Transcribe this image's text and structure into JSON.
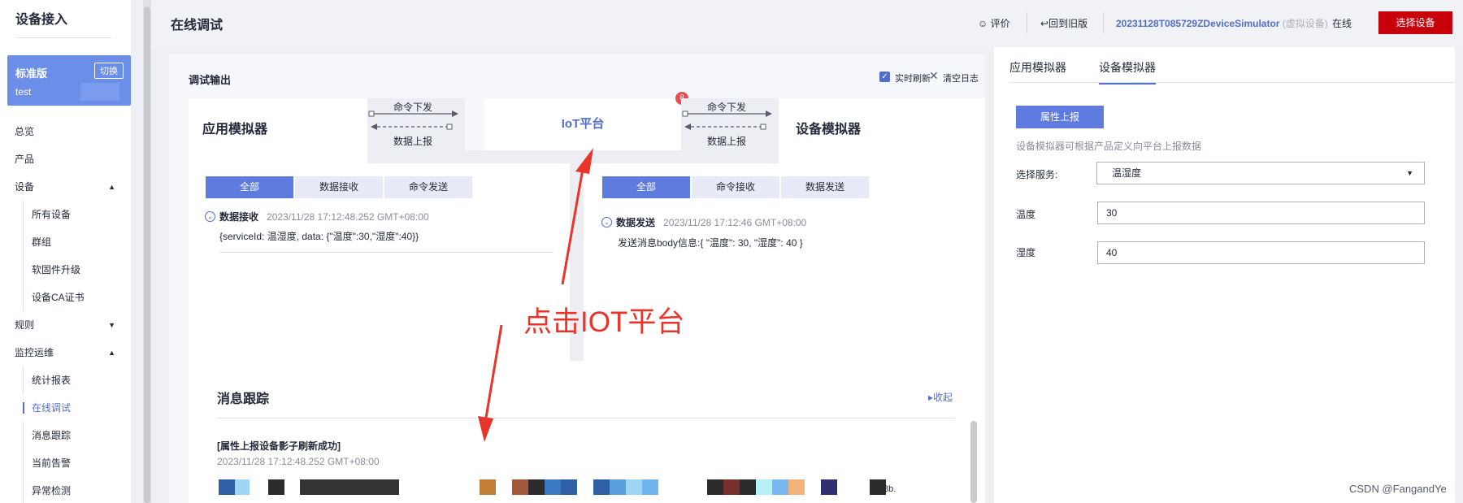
{
  "sidebar": {
    "title": "设备接入",
    "edition": {
      "name": "标准版",
      "switch_label": "切换",
      "instance": "test"
    },
    "menu": [
      {
        "label": "总览",
        "level": 1
      },
      {
        "label": "产品",
        "level": 1
      },
      {
        "label": "设备",
        "level": 1,
        "expanded": true
      },
      {
        "label": "所有设备",
        "level": 2
      },
      {
        "label": "群组",
        "level": 2
      },
      {
        "label": "软固件升级",
        "level": 2
      },
      {
        "label": "设备CA证书",
        "level": 2
      },
      {
        "label": "规则",
        "level": 1,
        "expanded": false
      },
      {
        "label": "监控运维",
        "level": 1,
        "expanded": true
      },
      {
        "label": "统计报表",
        "level": 2
      },
      {
        "label": "在线调试",
        "level": 2,
        "active": true
      },
      {
        "label": "消息跟踪",
        "level": 2
      },
      {
        "label": "当前告警",
        "level": 2
      },
      {
        "label": "异常检测",
        "level": 2
      }
    ]
  },
  "header": {
    "title": "在线调试",
    "rate_label": "评价",
    "back_label": "回到旧版",
    "device_name": "20231128T085729ZDeviceSimulator",
    "device_tag": "(虚拟设备)",
    "status": "在线",
    "select_device_label": "选择设备"
  },
  "debug": {
    "title": "调试输出",
    "realtime_label": "实时刷新",
    "clear_label": "清空日志",
    "app_sim_label": "应用模拟器",
    "dev_sim_label": "设备模拟器",
    "iot_label": "IoT平台",
    "badge": "8",
    "flow_down": "命令下发",
    "flow_up": "数据上报",
    "left_tabs": [
      "全部",
      "数据接收",
      "命令发送"
    ],
    "right_tabs": [
      "全部",
      "命令接收",
      "数据发送"
    ],
    "left_log": {
      "kind": "数据接收",
      "time": "2023/11/28 17:12:48.252 GMT+08:00",
      "body": "{serviceId: 温湿度, data: {\"温度\":30,\"湿度\":40}}"
    },
    "right_log": {
      "kind": "数据发送",
      "time": "2023/11/28 17:12:46 GMT+08:00",
      "body": "发送消息body信息:{ \"温度\": 30, \"湿度\": 40 }"
    }
  },
  "trace": {
    "title": "消息跟踪",
    "collapse_label": "收起",
    "message": "[属性上报设备影子刷新成功]",
    "time": "2023/11/28 17:12:48.252 GMT+08:00",
    "tail_text": "8b."
  },
  "right_panel": {
    "tabs": [
      "应用模拟器",
      "设备模拟器"
    ],
    "active_tab": "设备模拟器",
    "report_button": "属性上报",
    "hint": "设备模拟器可根据产品定义向平台上报数据",
    "service_label": "选择服务:",
    "service_value": "温湿度",
    "temp_label": "温度",
    "temp_value": "30",
    "hum_label": "湿度",
    "hum_value": "40"
  },
  "annotation": {
    "text": "点击IOT平台",
    "color": "#e8342a"
  },
  "watermark": "CSDN @FangandYe",
  "colors": {
    "accent": "#5e7ce0",
    "link": "#526ecc",
    "danger": "#c7000b",
    "badge": "#e64c4c"
  }
}
